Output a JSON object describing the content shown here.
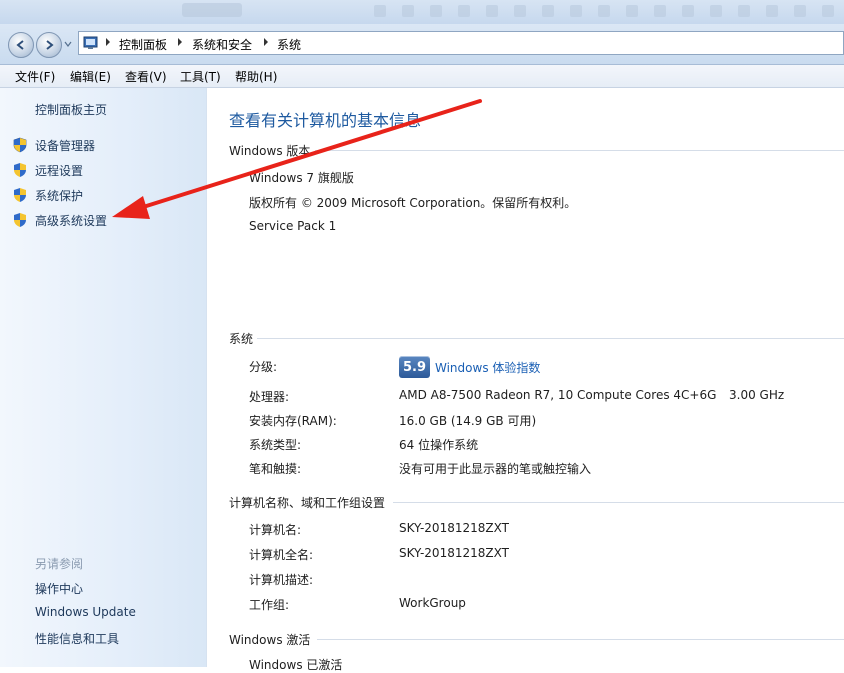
{
  "address_bar": {
    "breadcrumbs": [
      "控制面板",
      "系统和安全",
      "系统"
    ]
  },
  "menu": [
    "文件(F)",
    "编辑(E)",
    "查看(V)",
    "工具(T)",
    "帮助(H)"
  ],
  "left_pane": {
    "home": "控制面板主页",
    "tasks": [
      "设备管理器",
      "远程设置",
      "系统保护",
      "高级系统设置"
    ],
    "see_also_title": "另请参阅",
    "see_also": [
      "操作中心",
      "Windows Update",
      "性能信息和工具"
    ]
  },
  "main": {
    "title": "查看有关计算机的基本信息",
    "edition": {
      "heading": "Windows 版本",
      "name": "Windows 7 旗舰版",
      "copyright": "版权所有 © 2009 Microsoft Corporation。保留所有权利。",
      "service_pack": "Service Pack 1"
    },
    "system": {
      "heading": "系统",
      "rating_label": "分级:",
      "rating_score": "5.9",
      "rating_link": "Windows 体验指数",
      "processor_label": "处理器:",
      "processor_value": "AMD A8-7500 Radeon R7, 10 Compute Cores 4C+6G",
      "processor_speed": "3.00 GHz",
      "ram_label": "安装内存(RAM):",
      "ram_value": "16.0 GB (14.9 GB 可用)",
      "type_label": "系统类型:",
      "type_value": "64 位操作系统",
      "pen_label": "笔和触摸:",
      "pen_value": "没有可用于此显示器的笔或触控输入"
    },
    "computer": {
      "heading": "计算机名称、域和工作组设置",
      "name_label": "计算机名:",
      "name_value": "SKY-20181218ZXT",
      "fullname_label": "计算机全名:",
      "fullname_value": "SKY-20181218ZXT",
      "desc_label": "计算机描述:",
      "workgroup_label": "工作组:",
      "workgroup_value": "WorkGroup"
    },
    "activation": {
      "heading": "Windows 激活",
      "status": "Windows 已激活"
    }
  },
  "colors": {
    "link": "#1a5fb4",
    "title": "#1e5aa0",
    "annotation_arrow": "#e8231a"
  }
}
